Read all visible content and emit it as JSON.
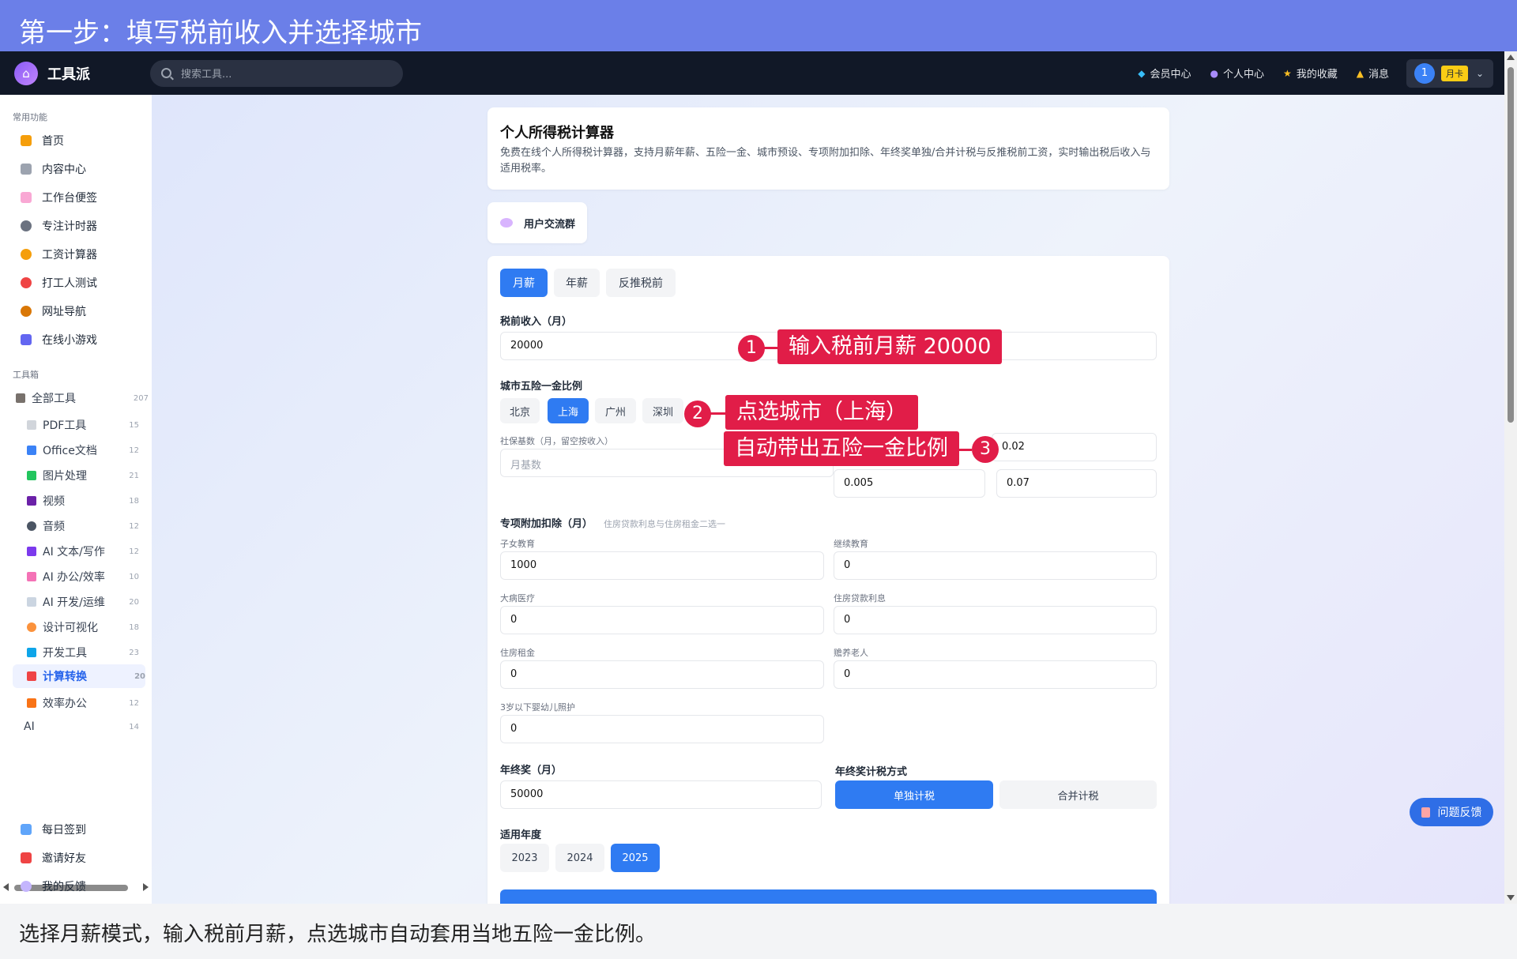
{
  "step_banner": "第一步：填写税前收入并选择城市",
  "caption": "选择月薪模式，输入税前月薪，点选城市自动套用当地五险一金比例。",
  "header": {
    "logo": "工具派",
    "search_placeholder": "搜索工具...",
    "nav": [
      "会员中心",
      "个人中心",
      "我的收藏",
      "消息"
    ],
    "avatar": "1",
    "badge": "月卡"
  },
  "sidebar": {
    "section1": "常用功能",
    "items": [
      "首页",
      "内容中心",
      "工作台便签",
      "专注计时器",
      "工资计算器",
      "打工人测试",
      "网址导航",
      "在线小游戏"
    ],
    "section2": "工具箱",
    "all_tools": "全部工具",
    "all_count": "207",
    "sub": [
      {
        "label": "PDF工具",
        "count": "15"
      },
      {
        "label": "Office文档",
        "count": "12"
      },
      {
        "label": "图片处理",
        "count": "21"
      },
      {
        "label": "视频",
        "count": "18"
      },
      {
        "label": "音频",
        "count": "12"
      },
      {
        "label": "AI 文本/写作",
        "count": "12"
      },
      {
        "label": "AI 办公/效率",
        "count": "10"
      },
      {
        "label": "AI 开发/运维",
        "count": "20"
      },
      {
        "label": "设计可视化",
        "count": "18"
      },
      {
        "label": "开发工具",
        "count": "23"
      },
      {
        "label": "计算转换",
        "count": "20"
      },
      {
        "label": "效率办公",
        "count": "12"
      },
      {
        "label": "AI",
        "count": "14"
      }
    ],
    "bottom": [
      "每日签到",
      "邀请好友",
      "我的反馈"
    ]
  },
  "calc": {
    "title": "个人所得税计算器",
    "desc": "免费在线个人所得税计算器，支持月薪年薪、五险一金、城市预设、专项附加扣除、年终奖单独/合并计税与反推税前工资，实时输出税后收入与适用税率。",
    "group_btn": "用户交流群",
    "modes": [
      "月薪",
      "年薪",
      "反推税前"
    ],
    "pretax_label": "税前收入（月）",
    "pretax_value": "20000",
    "city_label": "城市五险一金比例",
    "cities": [
      "北京",
      "上海",
      "广州",
      "深圳"
    ],
    "base_label": "社保基数（月，留空按收入）",
    "base_placeholder": "月基数",
    "rates": [
      "0.02",
      "0.005",
      "0.07"
    ],
    "deduct_label": "专项附加扣除（月）",
    "deduct_hint": "住房贷款利息与住房租金二选一",
    "deductions": [
      {
        "label": "子女教育",
        "value": "1000"
      },
      {
        "label": "继续教育",
        "value": "0"
      },
      {
        "label": "大病医疗",
        "value": "0"
      },
      {
        "label": "住房贷款利息",
        "value": "0"
      },
      {
        "label": "住房租金",
        "value": "0"
      },
      {
        "label": "赡养老人",
        "value": "0"
      },
      {
        "label": "3岁以下婴幼儿照护",
        "value": "0"
      }
    ],
    "bonus_label": "年终奖（月）",
    "bonus_value": "50000",
    "bonus_method_label": "年终奖计税方式",
    "bonus_methods": [
      "单独计税",
      "合并计税"
    ],
    "year_label": "适用年度",
    "years": [
      "2023",
      "2024",
      "2025"
    ]
  },
  "annotations": [
    {
      "num": "1",
      "text": "输入税前月薪 20000"
    },
    {
      "num": "2",
      "text": "点选城市（上海）"
    },
    {
      "num": "3",
      "text": "自动带出五险一金比例"
    }
  ],
  "feedback": "问题反馈"
}
